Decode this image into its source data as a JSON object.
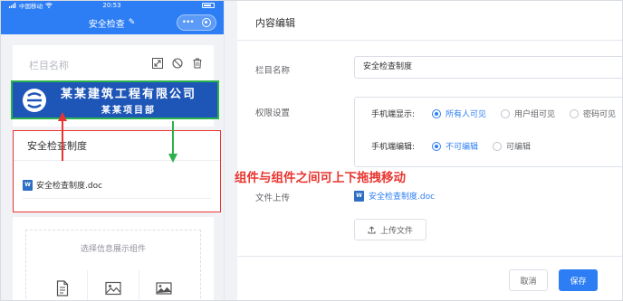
{
  "status_bar": {
    "carrier": "中国移动",
    "time": "20:53"
  },
  "phone_nav": {
    "title": "安全检查"
  },
  "column_card": {
    "placeholder_name": "栏目名称"
  },
  "banner": {
    "line1": "某某建筑工程有限公司",
    "line2": "某某项目部",
    "bg_color": "#1e56b8"
  },
  "doc_card": {
    "title": "安全检查制度",
    "file_name": "安全检查制度.doc"
  },
  "picker": {
    "label": "选择信息展示组件",
    "icons": [
      "document-icon",
      "image-icon",
      "gallery-icon"
    ]
  },
  "annotation": {
    "text": "组件与组件之间可上下拖拽移动",
    "color": "#e8352f"
  },
  "editor": {
    "title": "内容编辑",
    "column_label": "栏目名称",
    "column_value": "安全检查制度",
    "permission_label": "权限设置",
    "view_label": "手机端显示:",
    "view_options": [
      "所有人可见",
      "用户组可见",
      "密码可见"
    ],
    "view_selected": 0,
    "edit_label": "手机端编辑:",
    "edit_options": [
      "不可编辑",
      "可编辑"
    ],
    "edit_selected": 0,
    "upload_label": "文件上传",
    "uploaded_file": "安全检查制度.doc",
    "upload_button": "上传文件",
    "cancel_button": "取消",
    "save_button": "保存"
  },
  "colors": {
    "primary": "#2d7ef5",
    "alert": "#e8352f",
    "drag_arrow": "#2bb24c"
  }
}
